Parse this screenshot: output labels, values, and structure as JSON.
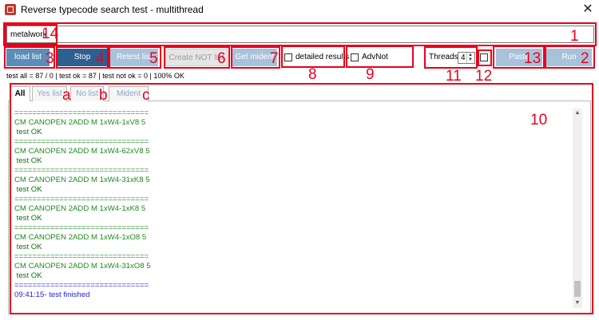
{
  "window": {
    "title": "Reverse typecode search test - multithread",
    "close": "✕"
  },
  "search": {
    "value": "metalwork"
  },
  "buttons": {
    "load_list": "load list",
    "stop": "Stop",
    "retest_list": "Retest list",
    "create_not_list": "Create NOT list",
    "get_mident": "Get mident",
    "paste": "Paste",
    "run": "Run"
  },
  "options": {
    "detailed_results": "detailed results",
    "advnot": "AdvNot",
    "threads_label": "Threads",
    "threads_value": "4"
  },
  "stats": "test all = 87 / 0 |   test ok = 87 |   test not ok = 0 |    100% OK",
  "tabs": [
    "All",
    "Yes list",
    "No list",
    "Mident"
  ],
  "log": [
    {
      "text": "==============================",
      "color": "green"
    },
    {
      "text": "CM CANOPEN 2ADD M 1xW4-1xV8 5",
      "color": "green"
    },
    {
      "text": " test OK",
      "color": "green-dark"
    },
    {
      "text": "==============================",
      "color": "green"
    },
    {
      "text": "CM CANOPEN 2ADD M 1xW4-62xV8 5",
      "color": "green"
    },
    {
      "text": " test OK",
      "color": "green-dark"
    },
    {
      "text": "==============================",
      "color": "green"
    },
    {
      "text": "CM CANOPEN 2ADD M 1xW4-31xK8 5",
      "color": "green"
    },
    {
      "text": " test OK",
      "color": "green-dark"
    },
    {
      "text": "==============================",
      "color": "green"
    },
    {
      "text": "CM CANOPEN 2ADD M 1xW4-1xK8 5",
      "color": "green"
    },
    {
      "text": " test OK",
      "color": "green-dark"
    },
    {
      "text": "==============================",
      "color": "green"
    },
    {
      "text": "CM CANOPEN 2ADD M 1xW4-1xO8 5",
      "color": "green"
    },
    {
      "text": " test OK",
      "color": "green-dark"
    },
    {
      "text": "==============================",
      "color": "green"
    },
    {
      "text": "CM CANOPEN 2ADD M 1xW4-31xO8 5",
      "color": "green"
    },
    {
      "text": " test OK",
      "color": "green-dark"
    },
    {
      "text": "==============================",
      "color": "blue"
    },
    {
      "text": "09:41:15- test finished",
      "color": "blue"
    }
  ],
  "annotations": {
    "n1": "1",
    "n2": "2",
    "n3": "3",
    "n4": "4",
    "n5": "5",
    "n6": "6",
    "n7": "7",
    "n8": "8",
    "n9": "9",
    "n10": "10",
    "n11": "11",
    "n12": "12",
    "n13": "13",
    "n14": "14",
    "a": "a",
    "b": "b",
    "c": "c"
  },
  "colors": {
    "annotation": "#e8001c",
    "btn_dark": "#2d5f8f",
    "btn_mid": "#5a8db8",
    "btn_light": "#a8c2da",
    "log_green": "#1f8a1f",
    "log_blue": "#2222dd"
  },
  "icons": {
    "app": "app-window-icon",
    "close": "close-icon",
    "scroll_up": "chevron-up-icon",
    "scroll_down": "chevron-down-icon"
  }
}
